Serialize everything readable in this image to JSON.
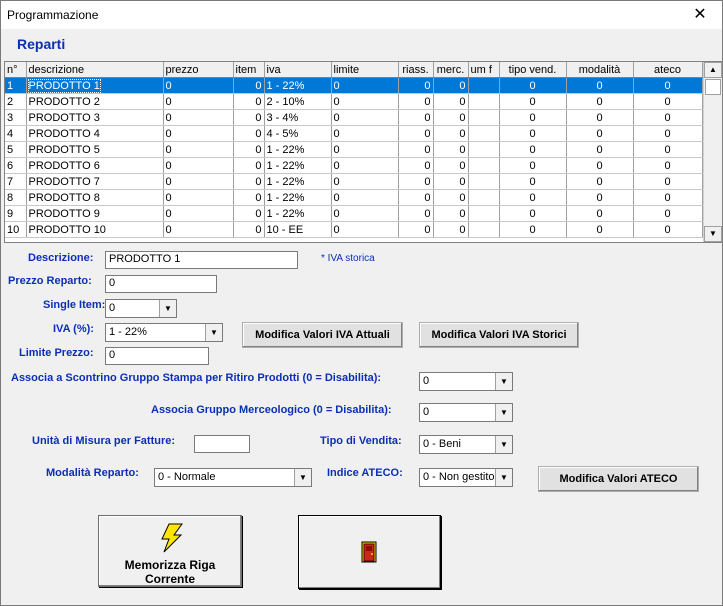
{
  "window": {
    "title": "Programmazione",
    "close_glyph": "✕"
  },
  "section_title": "Reparti",
  "grid": {
    "columns": [
      "n°",
      "descrizione",
      "prezzo",
      "item",
      "iva",
      "limite",
      "riass.",
      "merc.",
      "um f",
      "tipo vend.",
      "modalità",
      "ateco"
    ],
    "selected_row": 0,
    "rows": [
      [
        "1",
        "PRODOTTO  1",
        "0",
        "0",
        "1 - 22%",
        "0",
        "0",
        "0",
        "",
        "0",
        "0",
        "0"
      ],
      [
        "2",
        "PRODOTTO  2",
        "0",
        "0",
        "2 - 10%",
        "0",
        "0",
        "0",
        "",
        "0",
        "0",
        "0"
      ],
      [
        "3",
        "PRODOTTO  3",
        "0",
        "0",
        "3 - 4%",
        "0",
        "0",
        "0",
        "",
        "0",
        "0",
        "0"
      ],
      [
        "4",
        "PRODOTTO  4",
        "0",
        "0",
        "4 - 5%",
        "0",
        "0",
        "0",
        "",
        "0",
        "0",
        "0"
      ],
      [
        "5",
        "PRODOTTO  5",
        "0",
        "0",
        "1 - 22%",
        "0",
        "0",
        "0",
        "",
        "0",
        "0",
        "0"
      ],
      [
        "6",
        "PRODOTTO  6",
        "0",
        "0",
        "1 - 22%",
        "0",
        "0",
        "0",
        "",
        "0",
        "0",
        "0"
      ],
      [
        "7",
        "PRODOTTO  7",
        "0",
        "0",
        "1 - 22%",
        "0",
        "0",
        "0",
        "",
        "0",
        "0",
        "0"
      ],
      [
        "8",
        "PRODOTTO  8",
        "0",
        "0",
        "1 - 22%",
        "0",
        "0",
        "0",
        "",
        "0",
        "0",
        "0"
      ],
      [
        "9",
        "PRODOTTO  9",
        "0",
        "0",
        "1 - 22%",
        "0",
        "0",
        "0",
        "",
        "0",
        "0",
        "0"
      ],
      [
        "10",
        "PRODOTTO 10",
        "0",
        "0",
        "10 - EE",
        "0",
        "0",
        "0",
        "",
        "0",
        "0",
        "0"
      ]
    ]
  },
  "form": {
    "descrizione_label": "Descrizione:",
    "descrizione_value": "PRODOTTO  1",
    "iva_storica_note": "* IVA storica",
    "prezzo_label": "Prezzo Reparto:",
    "prezzo_value": "0",
    "single_item_label": "Single Item:",
    "single_item_value": "0",
    "iva_label": "IVA (%):",
    "iva_value": "1 - 22%",
    "btn_iva_attuali": "Modifica Valori IVA Attuali",
    "btn_iva_storici": "Modifica Valori IVA Storici",
    "limite_label": "Limite Prezzo:",
    "limite_value": "0",
    "scontrino_label": "Associa a Scontrino Gruppo Stampa per Ritiro Prodotti (0 = Disabilita):",
    "scontrino_value": "0",
    "merceologico_label": "Associa Gruppo Merceologico (0 = Disabilita):",
    "merceologico_value": "0",
    "unita_label": "Unità di Misura per Fatture:",
    "unita_value": "",
    "tipo_vendita_label": "Tipo di Vendita:",
    "tipo_vendita_value": "0 - Beni",
    "modalita_label": "Modalità Reparto:",
    "modalita_value": "0 - Normale",
    "ateco_label": "Indice ATECO:",
    "ateco_value": "0 - Non gestito",
    "btn_ateco": "Modifica Valori ATECO"
  },
  "actions": {
    "save_line1": "Memorizza Riga",
    "save_line2": "Corrente",
    "save_icon": "lightning-icon",
    "exit_icon": "door-exit-icon"
  },
  "colors": {
    "label_blue": "#0b2fb3",
    "selection": "#0078d7"
  }
}
